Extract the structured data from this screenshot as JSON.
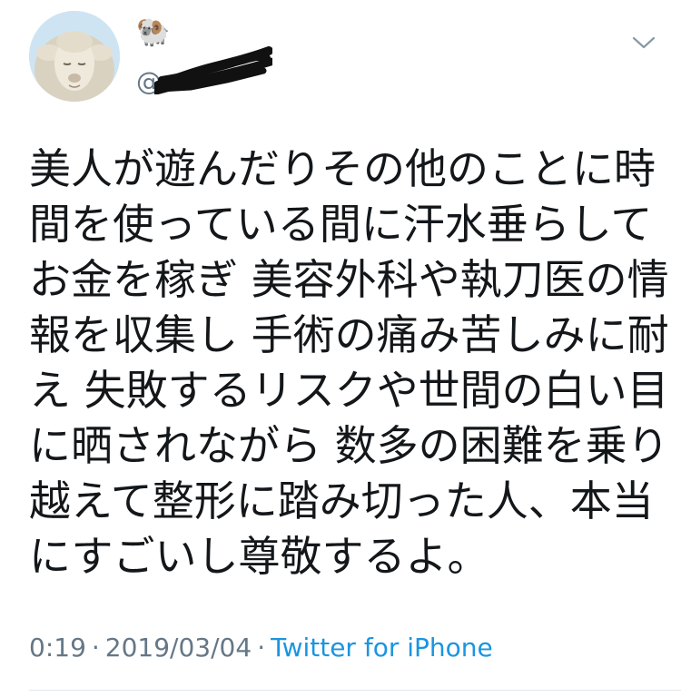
{
  "author": {
    "display_name": "🐏",
    "handle_prefix": "@",
    "avatar_icon": "sheep-avatar",
    "more_icon": "chevron-down-icon"
  },
  "tweet": {
    "text_lines": [
      "美人が遊んだりその他のことに時",
      "間を使っている間に汗水垂らして",
      "お金を稼ぎ 美容外科や執刀医の情",
      "報を収集し 手術の痛み苦しみに耐",
      "え 失敗するリスクや世間の白い目",
      "に晒されながら 数多の困難を乗り",
      "越えて整形に踏み切った人、本当",
      "にすごいし尊敬するよ。"
    ]
  },
  "meta": {
    "time": "0:19",
    "separator": "·",
    "date": "2019/03/04",
    "source": "Twitter for iPhone"
  },
  "colors": {
    "text": "#14171a",
    "secondary": "#657786",
    "link": "#1b95e0",
    "divider": "#e1e8ed"
  }
}
